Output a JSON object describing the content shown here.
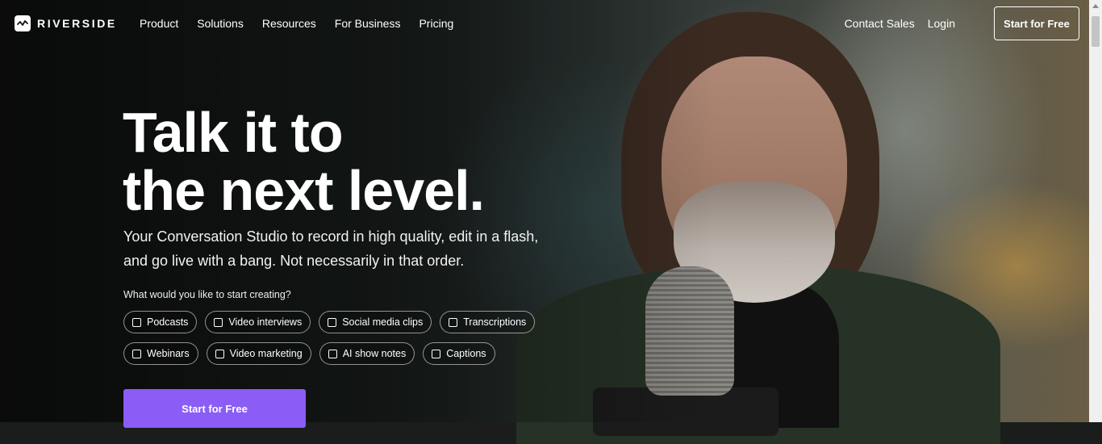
{
  "brand": {
    "name": "RIVERSIDE"
  },
  "nav": {
    "links": [
      "Product",
      "Solutions",
      "Resources",
      "For Business",
      "Pricing"
    ],
    "contact_sales": "Contact Sales",
    "login": "Login",
    "cta": "Start for Free"
  },
  "hero": {
    "headline_line1": "Talk it to",
    "headline_line2": "the next level.",
    "subhead_line1": "Your Conversation Studio to record in high quality, edit in a flash,",
    "subhead_line2": "and go live with a bang. Not necessarily in that order.",
    "question": "What would you like to start creating?",
    "options_row1": [
      "Podcasts",
      "Video interviews",
      "Social media clips",
      "Transcriptions"
    ],
    "options_row2": [
      "Webinars",
      "Video marketing",
      "AI show notes",
      "Captions"
    ],
    "cta": "Start for Free"
  },
  "colors": {
    "accent": "#8b5cf6"
  }
}
